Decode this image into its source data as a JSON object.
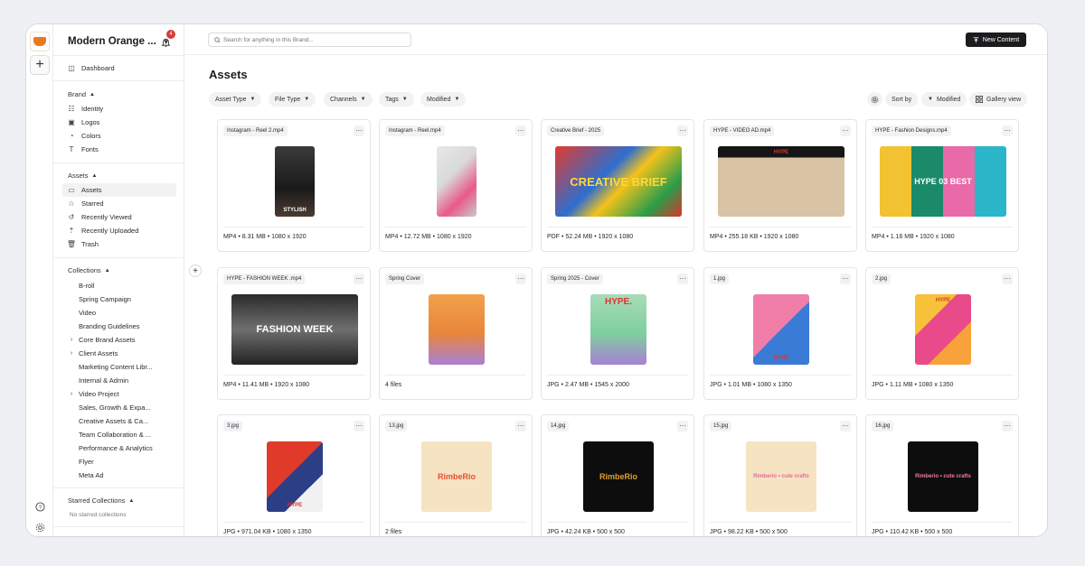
{
  "brand": {
    "name": "Modern Orange ...",
    "notification_count": "4"
  },
  "topbar": {
    "search_placeholder": "Search for anything in this Brand...",
    "new_content_label": "New Content"
  },
  "sidebar": {
    "dashboard": "Dashboard",
    "brand_section": "Brand",
    "brand_items": [
      "Identity",
      "Logos",
      "Colors",
      "Fonts"
    ],
    "assets_section": "Assets",
    "assets_items": [
      "Assets",
      "Starred",
      "Recently Viewed",
      "Recently Uploaded",
      "Trash"
    ],
    "collections_section": "Collections",
    "collections": [
      {
        "label": "B-roll",
        "expandable": false
      },
      {
        "label": "Spring Campaign",
        "expandable": false
      },
      {
        "label": "Video",
        "expandable": false
      },
      {
        "label": "Branding Guidelines",
        "expandable": false
      },
      {
        "label": "Core Brand Assets",
        "expandable": true
      },
      {
        "label": "Client Assets",
        "expandable": true
      },
      {
        "label": "Marketing Content Libr...",
        "expandable": false
      },
      {
        "label": "Internal & Admin",
        "expandable": false
      },
      {
        "label": "Video Project",
        "expandable": true
      },
      {
        "label": "Sales, Growth & Expa...",
        "expandable": false
      },
      {
        "label": "Creative Assets & Ca...",
        "expandable": false
      },
      {
        "label": "Team Collaboration & ...",
        "expandable": false
      },
      {
        "label": "Performance & Analytics",
        "expandable": false
      },
      {
        "label": "Flyer",
        "expandable": false
      },
      {
        "label": "Meta Ad",
        "expandable": false
      }
    ],
    "starred_section": "Starred Collections",
    "starred_empty": "No starred collections"
  },
  "main": {
    "title": "Assets",
    "filters": [
      "Asset Type",
      "File Type",
      "Channels",
      "Tags",
      "Modified"
    ],
    "sort_label": "Sort by",
    "sort_value": "Modified",
    "view_label": "Gallery view"
  },
  "assets": [
    {
      "name": "Instagram - Reel 2.mp4",
      "meta": "MP4 • 8.31 MB • 1080 x 1920",
      "thumb_text": "STYLISH"
    },
    {
      "name": "Instagram - Reel.mp4",
      "meta": "MP4 • 12.72 MB • 1080 x 1920",
      "thumb_text": ""
    },
    {
      "name": "Creative Brief - 2025",
      "meta": "PDF • 52.24 MB • 1920 x 1080",
      "thumb_text": "CREATIVE BRIEF"
    },
    {
      "name": "HYPE - VIDEO AD.mp4",
      "meta": "MP4 • 255.18 KB • 1920 x 1080",
      "thumb_text": "HYPE"
    },
    {
      "name": "HYPE - Fashion Designs.mp4",
      "meta": "MP4 • 1.16 MB • 1920 x 1080",
      "thumb_text": "HYPE 03 BEST"
    },
    {
      "name": "HYPE - FASHION WEEK .mp4",
      "meta": "MP4 • 11.41 MB • 1920 x 1080",
      "thumb_text": "FASHION WEEK"
    },
    {
      "name": "Spring Cover",
      "meta": "4 files",
      "thumb_text": ""
    },
    {
      "name": "Spring 2025 - Cover",
      "meta": "JPG • 2.47 MB • 1545 x 2000",
      "thumb_text": "HYPE."
    },
    {
      "name": "1.jpg",
      "meta": "JPG • 1.01 MB • 1080 x 1350",
      "thumb_text": "HYPE"
    },
    {
      "name": "2.jpg",
      "meta": "JPG • 1.11 MB • 1080 x 1350",
      "thumb_text": "HYPE"
    },
    {
      "name": "3.jpg",
      "meta": "JPG • 971.04 KB • 1080 x 1350",
      "thumb_text": "HYPE"
    },
    {
      "name": "13.jpg",
      "meta": "2 files",
      "thumb_text": "RimbeRio"
    },
    {
      "name": "14.jpg",
      "meta": "JPG • 42.24 KB • 500 x 500",
      "thumb_text": "RimbeRio"
    },
    {
      "name": "15.jpg",
      "meta": "JPG • 98.22 KB • 500 x 500",
      "thumb_text": "Rimberio • cute crafts"
    },
    {
      "name": "16.jpg",
      "meta": "JPG • 110.42 KB • 500 x 500",
      "thumb_text": "Rimberio • cute crafts"
    }
  ],
  "colors": {
    "accent_dark": "#1c1c1e",
    "badge_red": "#d73a3a",
    "brand_orange": "#e8791c"
  }
}
